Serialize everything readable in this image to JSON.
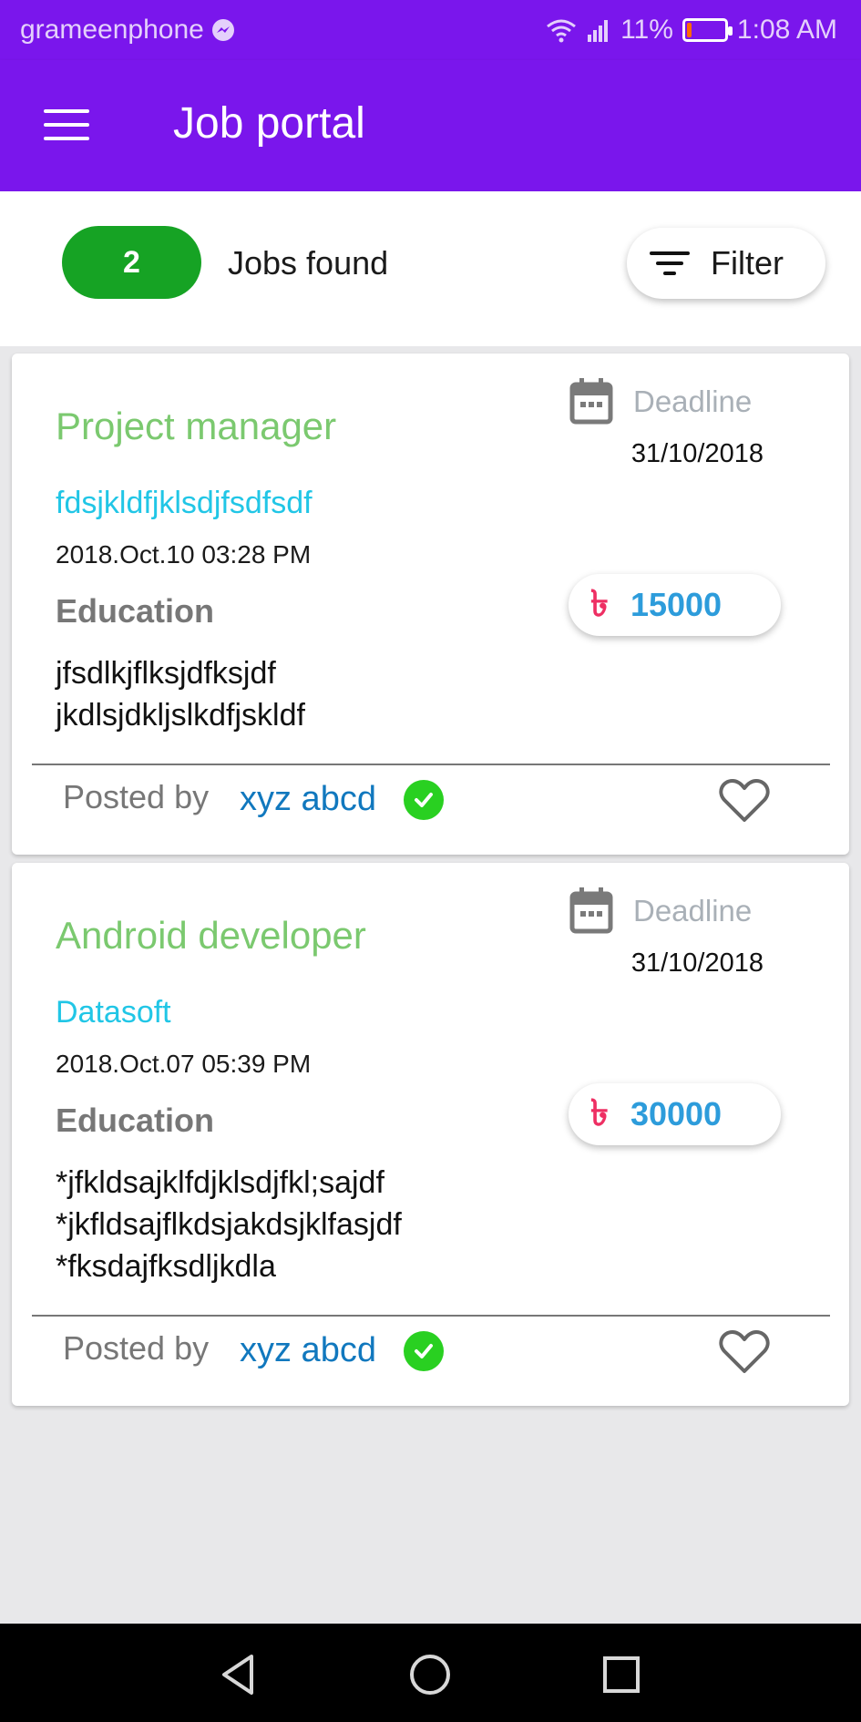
{
  "status_bar": {
    "carrier": "grameenphone",
    "battery": "11%",
    "battery_level": 0.11,
    "time": "1:08 AM",
    "icons": [
      "messenger-icon",
      "wifi-icon",
      "signal-icon",
      "battery-icon"
    ]
  },
  "app_bar": {
    "title": "Job portal",
    "menu_icon": "hamburger-menu-icon"
  },
  "summary": {
    "count": "2",
    "label": "Jobs found",
    "filter_label": "Filter",
    "filter_icon": "filter-icon",
    "count_color": "#16a324"
  },
  "jobs": [
    {
      "title": "Project manager",
      "company": "fdsjkldfjklsdjfsdfsdf",
      "posted_date": "2018.Oct.10 03:28 PM",
      "education_label": "Education",
      "education_lines": [
        "jfsdlkjflksjdfksjdf",
        "jkdlsjdkljslkdfjskldf"
      ],
      "deadline_label": "Deadline",
      "deadline_date": "31/10/2018",
      "currency_symbol": "৳",
      "salary": "15000",
      "posted_by_label": "Posted by",
      "poster": "xyz abcd"
    },
    {
      "title": "Android developer",
      "company": "Datasoft",
      "posted_date": "2018.Oct.07 05:39 PM",
      "education_label": "Education",
      "education_lines": [
        "*jfkldsajklfdjklsdjfkl;sajdf",
        "*jkfldsajflkdsjakdsjklfasjdf",
        "*fksdajfksdljkdla"
      ],
      "deadline_label": "Deadline",
      "deadline_date": "31/10/2018",
      "currency_symbol": "৳",
      "salary": "30000",
      "posted_by_label": "Posted by",
      "poster": "xyz abcd"
    }
  ],
  "colors": {
    "app_bar": "#7a16ec",
    "job_title": "#7bc96f",
    "company": "#21c6e6",
    "salary": "#2d9cdb",
    "currency": "#ee2f63",
    "poster": "#1178be",
    "verified": "#29d021"
  },
  "nav": {
    "icons": [
      "back-icon",
      "home-icon",
      "recents-icon"
    ]
  }
}
